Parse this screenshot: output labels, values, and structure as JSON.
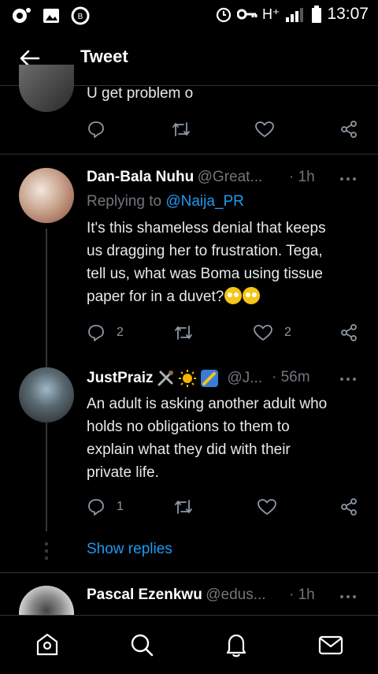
{
  "status": {
    "time": "13:07",
    "network": "H⁺"
  },
  "header": {
    "title": "Tweet"
  },
  "tweet0": {
    "text": "U get problem o"
  },
  "tweet1": {
    "name": "Dan-Bala Nuhu",
    "handle": "@Great...",
    "time": "· 1h",
    "replying_prefix": "Replying to",
    "replying_handle": "@Naija_PR",
    "lines": [
      "It's this shameless denial that keeps",
      "us dragging her to frustration. Tega,",
      "tell us, what was Boma using tissue",
      "paper for in a duvet?"
    ],
    "reply_count": "2",
    "like_count": "2"
  },
  "tweet2": {
    "name": "JustPraiz",
    "handle": "@J...",
    "time": "· 56m",
    "lines": [
      "An adult is asking another adult who",
      "holds no obligations to them to",
      "explain what they did with their",
      "private life."
    ],
    "reply_count": "1",
    "show_replies": "Show replies"
  },
  "tweet3": {
    "name": "Pascal Ezenkwu",
    "handle": "@edus...",
    "time": "· 1h"
  },
  "colors": {
    "accent": "#1d9bf0",
    "background": "#000000",
    "divider": "#2f3336"
  },
  "icons": [
    "reply-icon",
    "retweet-icon",
    "like-icon",
    "share-icon",
    "home-icon",
    "search-icon",
    "notifications-icon",
    "messages-icon",
    "more-icon",
    "back-arrow-icon"
  ]
}
